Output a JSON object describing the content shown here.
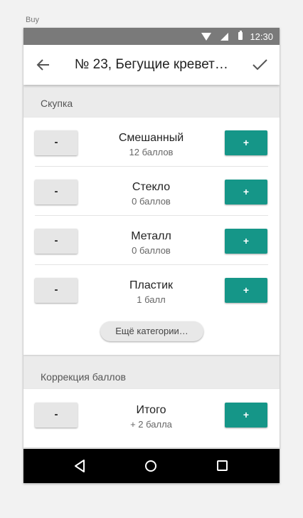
{
  "page_label": "Buy",
  "status_bar": {
    "time": "12:30"
  },
  "toolbar": {
    "title": "№ 23, Бегущие кревет…"
  },
  "sections": {
    "purchase_header": "Скупка",
    "correction_header": "Коррекция баллов"
  },
  "buttons": {
    "minus_label": "-",
    "plus_label": "+"
  },
  "categories": [
    {
      "name": "Смешанный",
      "points": "12 баллов"
    },
    {
      "name": "Стекло",
      "points": "0 баллов"
    },
    {
      "name": "Металл",
      "points": "0 баллов"
    },
    {
      "name": "Пластик",
      "points": "1 балл"
    }
  ],
  "more_categories_label": "Ещё категории…",
  "total": {
    "name": "Итого",
    "points": "+ 2 балла"
  },
  "colors": {
    "accent": "#159688",
    "status_bar": "#7a7a7a",
    "nav_bar": "#000000"
  }
}
